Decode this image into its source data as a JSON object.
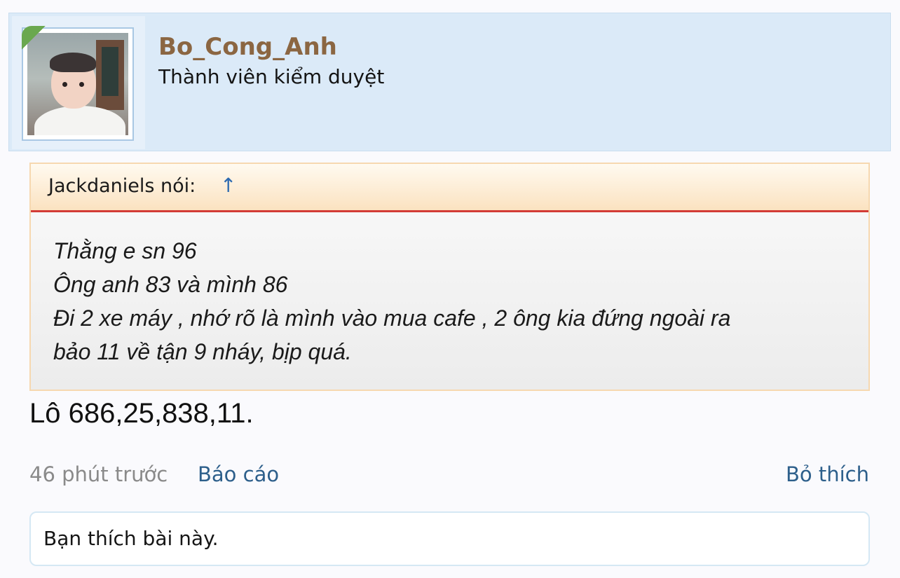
{
  "post": {
    "username": "Bo_Cong_Anh",
    "user_title": "Thành viên kiểm duyệt",
    "quote": {
      "author_label": "Jackdaniels nói:",
      "arrow": "↑",
      "lines": [
        "Thằng e sn 96",
        "Ông anh 83 và mình 86",
        "Đi 2 xe máy , nhớ rõ là mình vào mua cafe , 2 ông kia đứng ngoài ra",
        "bảo 11 về tận 9 nháy, bịp quá."
      ]
    },
    "message": "Lô 686,25,838,11.",
    "time": "46 phút trước",
    "report_label": "Báo cáo",
    "unlike_label": "Bỏ thích",
    "likes_text": "Bạn thích bài này."
  },
  "colors": {
    "header_bg": "#dbeaf8",
    "username": "#8b6642",
    "link": "#2d5f8b",
    "quote_border": "#d33b36"
  }
}
